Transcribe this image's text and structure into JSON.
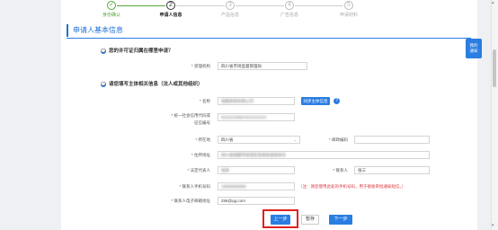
{
  "stepper": {
    "steps": [
      {
        "num": "✓",
        "label": "身份确认",
        "state": "done"
      },
      {
        "num": "2",
        "label": "申请人信息",
        "state": "active"
      },
      {
        "num": "3",
        "label": "产品信息",
        "state": "todo"
      },
      {
        "num": "4",
        "label": "广告信息",
        "state": "todo"
      },
      {
        "num": "5",
        "label": "申请材料",
        "state": "todo"
      }
    ]
  },
  "section": {
    "title": "申请人基本信息"
  },
  "q1": {
    "text": "您的许可证归属在哪里申请？",
    "office_label": "* 受理机构",
    "office_value": "四川省市场监督管理局"
  },
  "q2": {
    "text": "请您填写主体相关信息（法人或其他组织）",
    "name_label": "* 名称",
    "name_value": "成都某某有限公司",
    "fetch_button": "同步主体信息",
    "help_icon": "?",
    "credit_label_1": "* 统一社会信用代码或",
    "credit_label_2": "征信编号",
    "credit_value": "91510100MA6XXXXXXX",
    "region_label": "* 所在地",
    "region_value": "四川省",
    "region_caret": "⌄",
    "postcode_label": "* 邮政编码",
    "postcode_value": "",
    "address_label": "* 住所地址",
    "address_value": "四川省成都市某某区某某街道某某号",
    "legal_label": "* 法定代表人",
    "legal_value": "张某",
    "contact_label": "* 联系人",
    "contact_value": "张三",
    "phone_label": "* 联系人手机号码",
    "phone_value": "18888888888",
    "phone_hint": "（注：请您使用此处的手机号码，用于接收审批通知短信。）",
    "email_label": "* 联系人电子邮箱地址",
    "email_value": "256@qq.com"
  },
  "actions": {
    "prev": "上一步",
    "save": "暂存",
    "next": "下一步"
  },
  "float_button": {
    "line1": "我的",
    "line2": "通知"
  },
  "colors": {
    "primary": "#2a7de1",
    "done": "#52a93a",
    "highlight": "#e02020",
    "hint": "#d9363e"
  }
}
